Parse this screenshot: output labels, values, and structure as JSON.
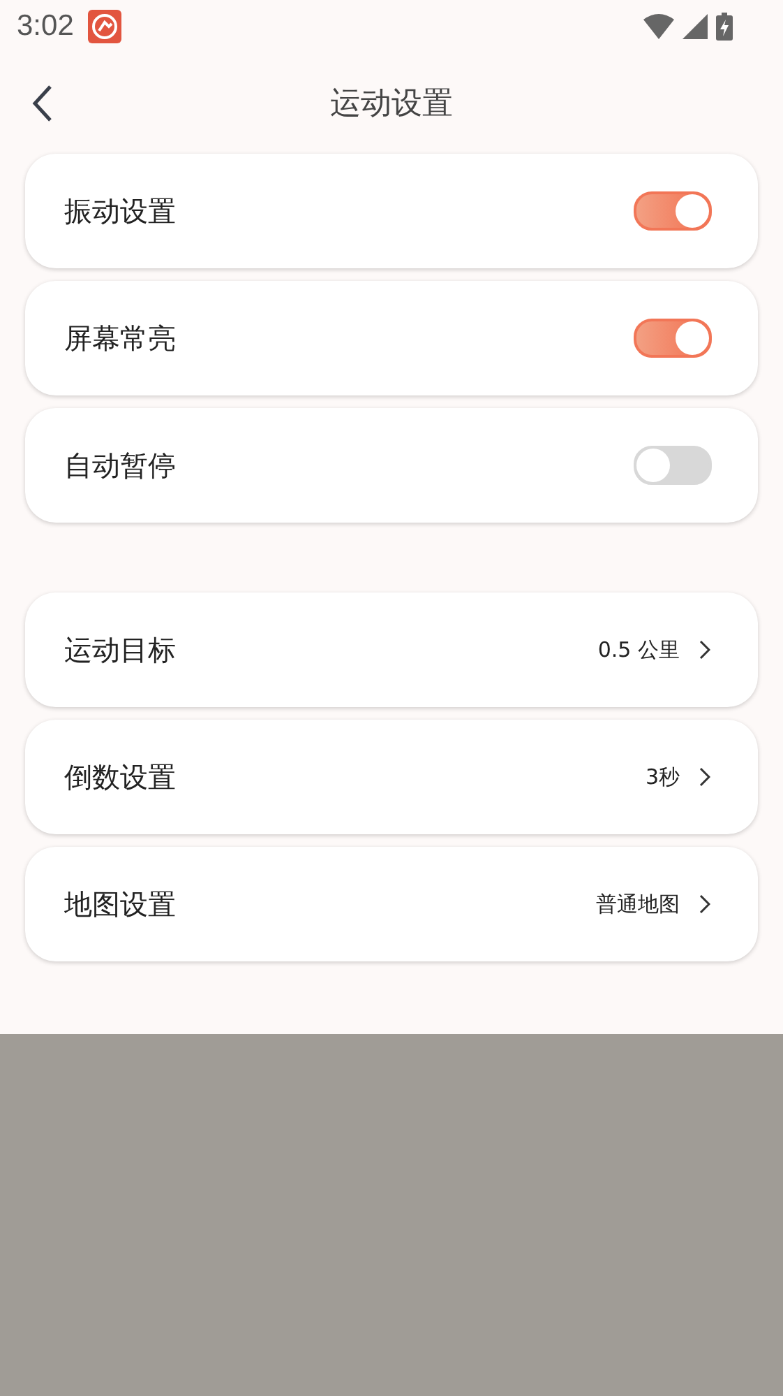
{
  "status_bar": {
    "time": "3:02"
  },
  "header": {
    "title": "运动设置"
  },
  "toggles": [
    {
      "label": "振动设置",
      "on": true
    },
    {
      "label": "屏幕常亮",
      "on": true
    },
    {
      "label": "自动暂停",
      "on": false
    }
  ],
  "options": [
    {
      "label": "运动目标",
      "value": "0.5 公里"
    },
    {
      "label": "倒数设置",
      "value": "3秒"
    },
    {
      "label": "地图设置",
      "value": "普通地图"
    }
  ]
}
